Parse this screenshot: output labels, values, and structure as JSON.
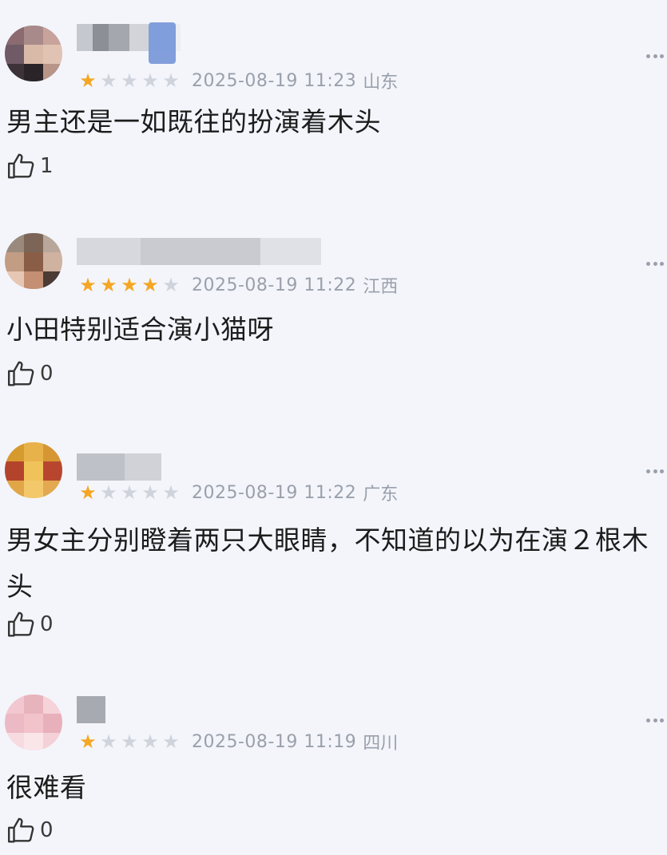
{
  "comments": [
    {
      "rating": 1,
      "timestamp": "2025-08-19 11:23",
      "region": "山东",
      "text": "男主还是一如既往的扮演着木头",
      "likes": "1"
    },
    {
      "rating": 4,
      "timestamp": "2025-08-19 11:22",
      "region": "江西",
      "text": "小田特别适合演小猫呀",
      "likes": "0"
    },
    {
      "rating": 1,
      "timestamp": "2025-08-19 11:22",
      "region": "广东",
      "text": "男女主分别瞪着两只大眼睛，不知道的以为在演２根木头",
      "likes": "0"
    },
    {
      "rating": 1,
      "timestamp": "2025-08-19 11:19",
      "region": "四川",
      "text": "很难看",
      "likes": "0"
    }
  ],
  "icons": {
    "more": "more-dots-icon",
    "like": "thumbs-up-icon",
    "star": "star-icon"
  },
  "colors": {
    "background": "#f3f5fb",
    "star_on": "#f5a623",
    "star_off": "#cfd3dc",
    "meta_text": "#9aa0ab"
  }
}
